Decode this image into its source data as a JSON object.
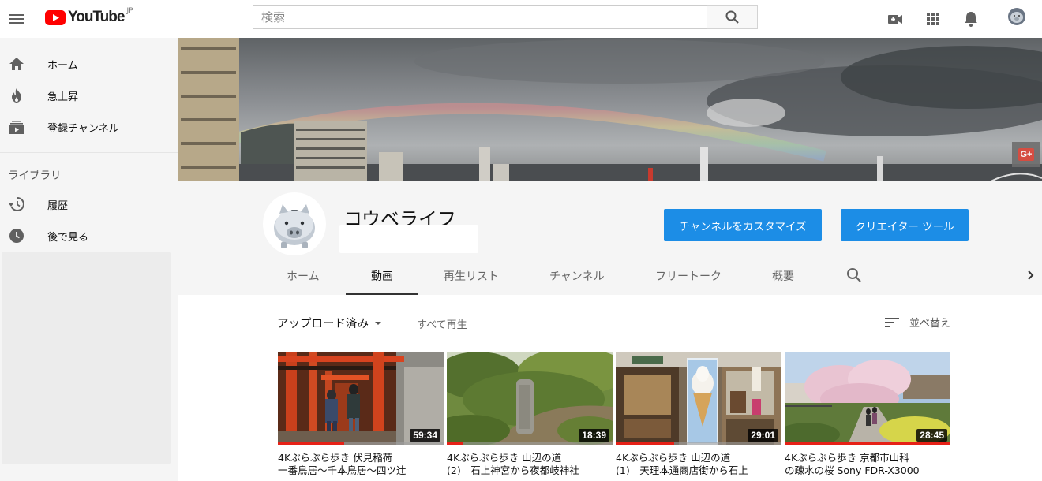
{
  "header": {
    "logo_text": "YouTube",
    "logo_region": "JP",
    "search_placeholder": "検索"
  },
  "sidebar": {
    "items": [
      {
        "label": "ホーム",
        "icon": "home-icon"
      },
      {
        "label": "急上昇",
        "icon": "flame-icon"
      },
      {
        "label": "登録チャンネル",
        "icon": "subscriptions-icon"
      }
    ],
    "library_heading": "ライブラリ",
    "library_items": [
      {
        "label": "履歴",
        "icon": "history-icon"
      },
      {
        "label": "後で見る",
        "icon": "clock-icon"
      }
    ]
  },
  "channel": {
    "name": "コウベライフ",
    "customize_button": "チャンネルをカスタマイズ",
    "creator_button": "クリエイター ツール",
    "tabs": [
      "ホーム",
      "動画",
      "再生リスト",
      "チャンネル",
      "フリートーク",
      "概要"
    ],
    "active_tab": "動画"
  },
  "videos_section": {
    "filter_label": "アップロード済み",
    "play_all": "すべて再生",
    "sort_label": "並べ替え"
  },
  "videos": [
    {
      "title_line1": "4Kぶらぶら歩き 伏見稲荷",
      "title_line2": "一番鳥居〜千本鳥居〜四ツ辻",
      "duration": "59:34",
      "progress": 0.4
    },
    {
      "title_line1": "4Kぶらぶら歩き 山辺の道",
      "title_line2": "(2)　石上神宮から夜都岐神社",
      "duration": "18:39",
      "progress": 0.1
    },
    {
      "title_line1": "4Kぶらぶら歩き 山辺の道",
      "title_line2": "(1)　天理本通商店街から石上",
      "duration": "29:01",
      "progress": 0.35
    },
    {
      "title_line1": "4Kぶらぶら歩き 京都市山科",
      "title_line2": "の疎水の桜 Sony FDR-X3000",
      "duration": "28:45",
      "progress": 1.0
    }
  ],
  "colors": {
    "brand_red": "#ff0000",
    "button_blue": "#1c8de6",
    "progress_red": "#e62117"
  }
}
